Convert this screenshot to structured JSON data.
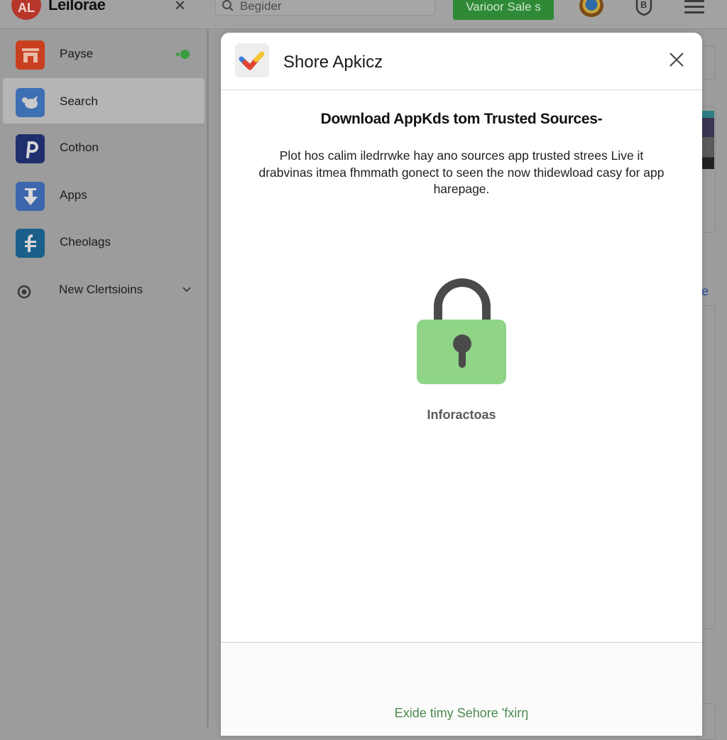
{
  "topbar": {
    "logo_text": "AL",
    "app_title": "Leilorae",
    "search_placeholder": "Begider",
    "promo_button": "Varioor Sale s"
  },
  "sidebar": {
    "items": [
      {
        "label": "Payse",
        "icon": "store-icon",
        "color": "#c8401f",
        "status": "online"
      },
      {
        "label": "Search",
        "icon": "bird-icon",
        "color": "#3d6fb3",
        "active": true
      },
      {
        "label": "Cothon",
        "icon": "p-logo-icon",
        "color": "#1f2f6e"
      },
      {
        "label": "Apps",
        "icon": "download-arrow-icon",
        "color": "#3d66ad"
      },
      {
        "label": "Cheolags",
        "icon": "f-logo-icon",
        "color": "#1b5f8a"
      },
      {
        "label": "New Clertsioins",
        "icon": "circle-icon",
        "expandable": true
      }
    ]
  },
  "background": {
    "link_fragment": "e"
  },
  "modal": {
    "title": "Shore Apkicz",
    "heading": "Download AppKds tom Trusted Sources-",
    "description": "Plot hos calim iledrrwke hay ano sources app trusted strees Live it drabvinas itmea fhmmath gonect to seen the now thidewload casy for app harepage.",
    "lock_caption": "Inforactoas",
    "footer_link": "Exide timy Sehore 'fxirŋ"
  },
  "colors": {
    "promo_green": "#2f8a37",
    "lock_green": "#8fd487",
    "lock_dark": "#4a4a4a",
    "footer_link_green": "#4e8a50",
    "logo_red": "#b8352a"
  }
}
